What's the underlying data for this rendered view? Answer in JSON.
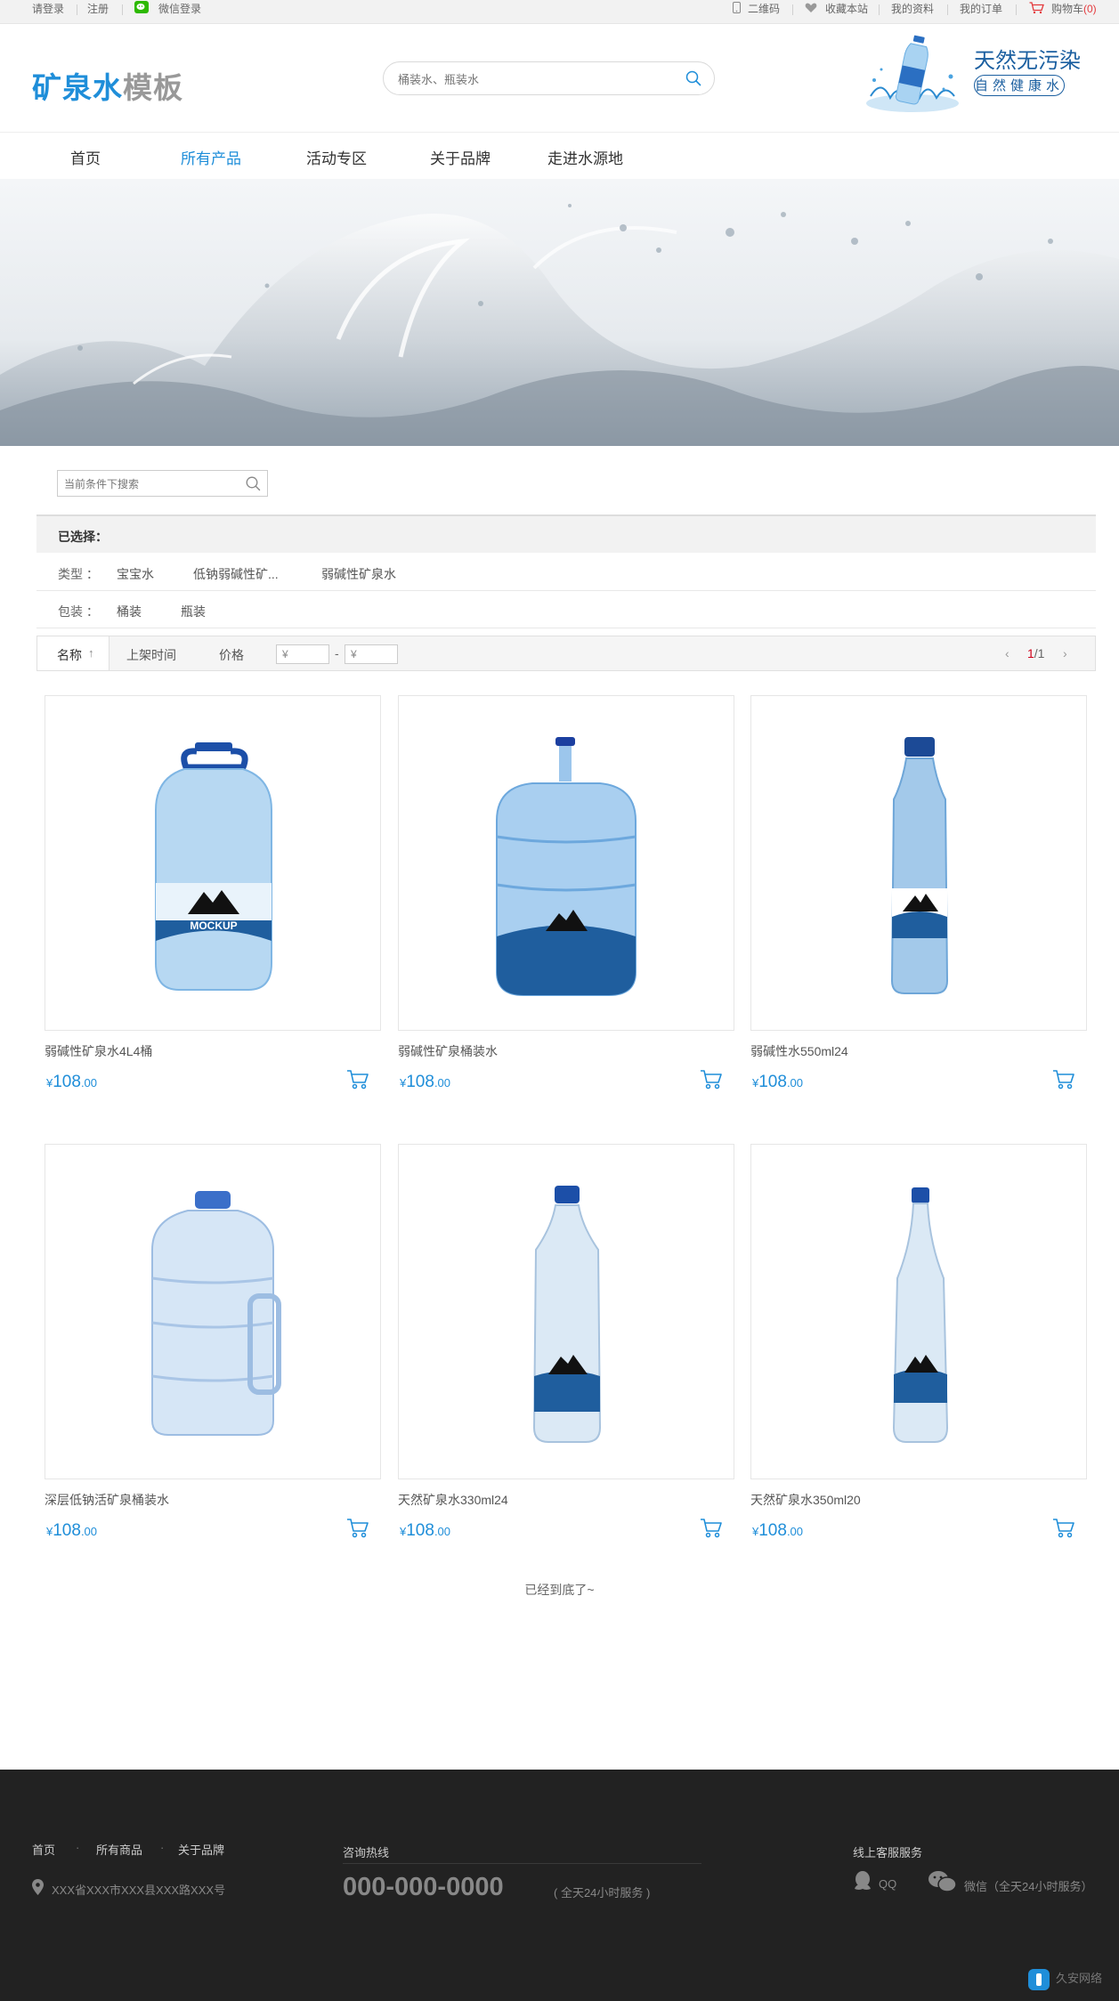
{
  "topbar": {
    "login": "请登录",
    "register": "注册",
    "wechat_login": "微信登录",
    "qrcode": "二维码",
    "favorite": "收藏本站",
    "profile": "我的资料",
    "orders": "我的订单",
    "cart": "购物车",
    "cart_count": "(0)"
  },
  "header": {
    "logo_a": "矿泉水",
    "logo_b": "模板",
    "search_placeholder": "桶装水、瓶装水",
    "promo_title": "天然无污染",
    "promo_sub": "自然健康水"
  },
  "nav": [
    "首页",
    "所有产品",
    "活动专区",
    "关于品牌",
    "走进水源地"
  ],
  "filter": {
    "search_placeholder": "当前条件下搜索",
    "selected_label": "已选择：",
    "type_label": "类型 ：",
    "types": [
      "宝宝水",
      "低钠弱碱性矿...",
      "弱碱性矿泉水"
    ],
    "pack_label": "包装 ：",
    "packs": [
      "桶装",
      "瓶装"
    ]
  },
  "sort": {
    "name": "名称",
    "name_arrow": "↑",
    "time": "上架时间",
    "price": "价格",
    "price_min": "¥",
    "price_max": "¥",
    "dash": "-",
    "prev": "‹",
    "next": "›",
    "page_current": "1",
    "page_total": "/1"
  },
  "products": [
    {
      "name": "弱碱性矿泉水4L4桶",
      "currency": "¥",
      "price_int": "108",
      "price_dec": ".00"
    },
    {
      "name": "弱碱性矿泉桶装水",
      "currency": "¥",
      "price_int": "108",
      "price_dec": ".00"
    },
    {
      "name": "弱碱性水550ml24",
      "currency": "¥",
      "price_int": "108",
      "price_dec": ".00"
    },
    {
      "name": "深层低钠活矿泉桶装水",
      "currency": "¥",
      "price_int": "108",
      "price_dec": ".00"
    },
    {
      "name": "天然矿泉水330ml24",
      "currency": "¥",
      "price_int": "108",
      "price_dec": ".00"
    },
    {
      "name": "天然矿泉水350ml20",
      "currency": "¥",
      "price_int": "108",
      "price_dec": ".00"
    }
  ],
  "bottom_text": "已经到底了~",
  "footer": {
    "links": [
      "首页",
      "所有商品",
      "关于品牌"
    ],
    "dot": "·",
    "address": "XXX省XXX市XXX县XXX路XXX号",
    "hotline_label": "咨询热线",
    "hotline": "000-000-0000",
    "hotline_note": "( 全天24小时服务 )",
    "service_label": "线上客服服务",
    "qq": "QQ",
    "wechat": "微信（全天24小时服务）",
    "watermark": "久安网络"
  },
  "colors": {
    "accent": "#1f8ed9",
    "brand_dark": "#1b5fa0",
    "footer_bg": "#222222",
    "page_red": "#d0021b"
  }
}
